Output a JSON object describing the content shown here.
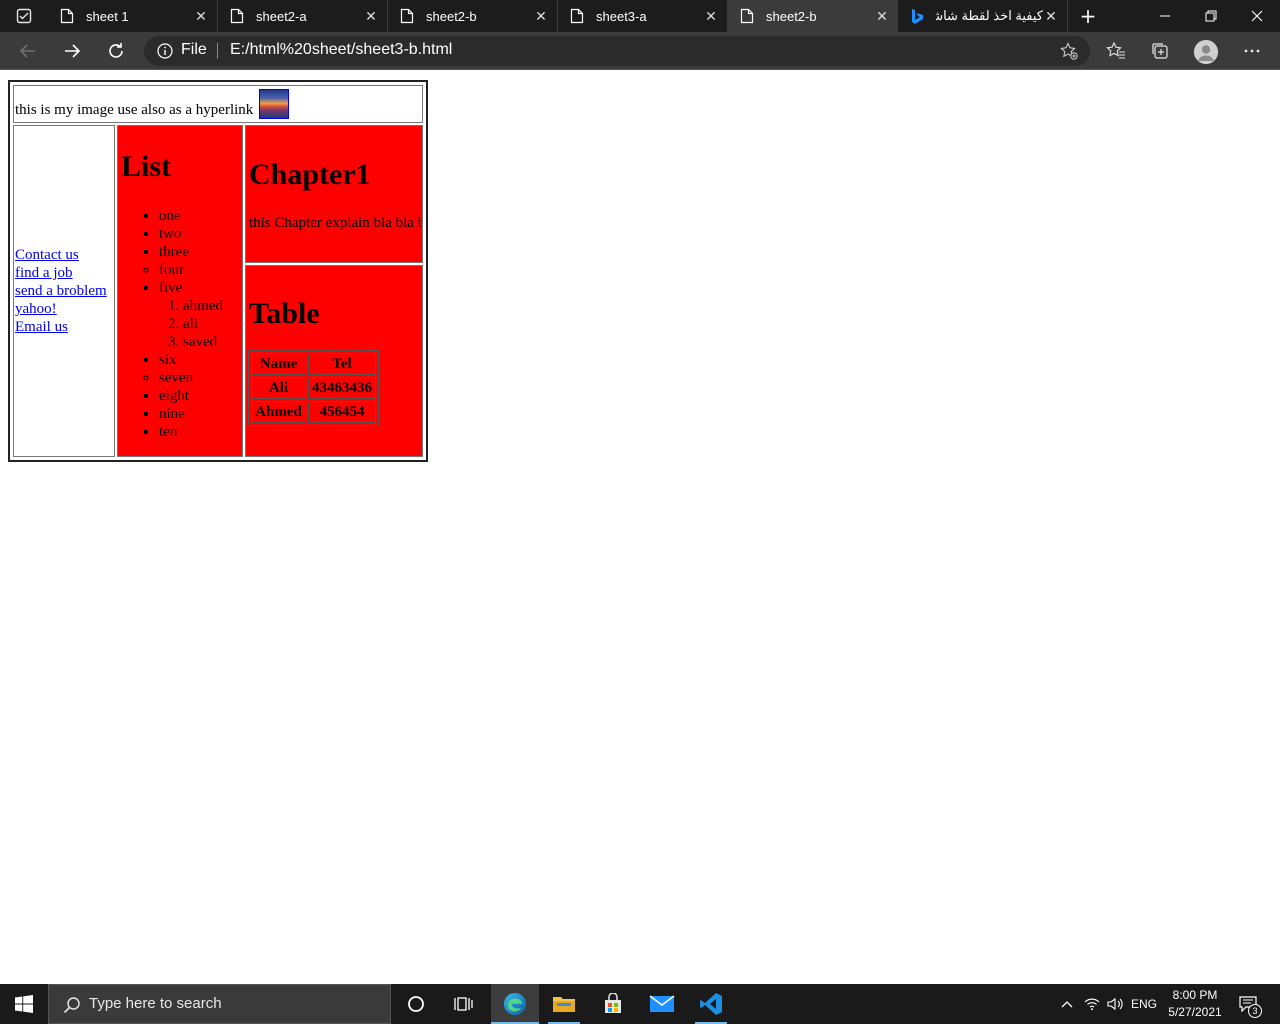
{
  "browser": {
    "tabs": [
      {
        "title": "sheet 1",
        "icon": "page-icon"
      },
      {
        "title": "sheet2-a",
        "icon": "page-icon"
      },
      {
        "title": "sheet2-b",
        "icon": "page-icon"
      },
      {
        "title": "sheet3-a",
        "icon": "page-icon"
      },
      {
        "title": "sheet2-b",
        "icon": "page-icon",
        "active": true
      },
      {
        "title": "كيفية اخذ لقطة شاشة",
        "icon": "bing-icon"
      }
    ],
    "address": {
      "scheme_label": "File",
      "url": "E:/html%20sheet/sheet3-b.html"
    }
  },
  "page": {
    "top_text": "this is my image use also as a hyperlink",
    "nav_links": [
      "Contact us",
      "find a job",
      "send a broblem",
      "yahoo!",
      "Email us"
    ],
    "list_heading": "List",
    "list_items_a": [
      "one",
      "two",
      "three"
    ],
    "list_item_four": "four",
    "list_item_five": "five",
    "sublist": [
      "ahmed",
      "ali",
      "saved"
    ],
    "list_item_six": "six",
    "list_item_seven": "seven",
    "list_items_b": [
      "eight",
      "nine",
      "ten"
    ],
    "chapter_heading": "Chapter1",
    "chapter_text": "this Chapter explain bla bla bla",
    "table_heading": "Table",
    "table": {
      "headers": [
        "Name",
        "Tel"
      ],
      "rows": [
        [
          "Ali",
          "43463436"
        ],
        [
          "Ahmed",
          "456454"
        ]
      ]
    }
  },
  "taskbar": {
    "search_placeholder": "Type here to search",
    "language": "ENG",
    "time": "8:00 PM",
    "date": "5/27/2021",
    "notification_count": "3"
  },
  "colors": {
    "cell_red": "#ff0000",
    "link_blue": "#0000ee",
    "chrome_dark": "#1c1c1c",
    "chrome_mid": "#3b3b3b",
    "taskbar": "#1a1a1a",
    "accent": "#76b9ed"
  }
}
